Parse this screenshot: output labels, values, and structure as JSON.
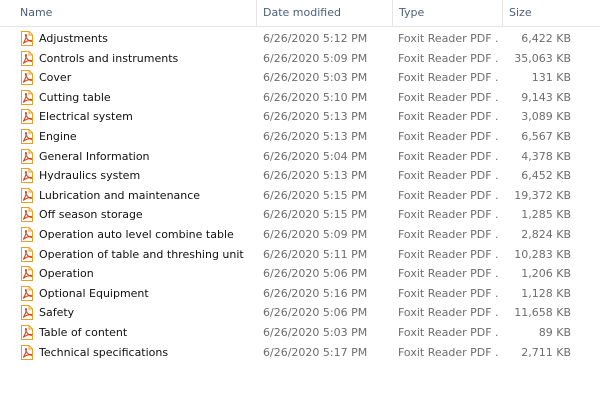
{
  "columns": {
    "name": "Name",
    "date": "Date modified",
    "type": "Type",
    "size": "Size"
  },
  "sort": {
    "column": "name",
    "arrow": "^"
  },
  "files": [
    {
      "name": "Adjustments",
      "date": "6/26/2020 5:12 PM",
      "type": "Foxit Reader PDF ...",
      "size": "6,422 KB"
    },
    {
      "name": "Controls and instruments",
      "date": "6/26/2020 5:09 PM",
      "type": "Foxit Reader PDF ...",
      "size": "35,063 KB"
    },
    {
      "name": "Cover",
      "date": "6/26/2020 5:03 PM",
      "type": "Foxit Reader PDF ...",
      "size": "131 KB"
    },
    {
      "name": "Cutting table",
      "date": "6/26/2020 5:10 PM",
      "type": "Foxit Reader PDF ...",
      "size": "9,143 KB"
    },
    {
      "name": "Electrical system",
      "date": "6/26/2020 5:13 PM",
      "type": "Foxit Reader PDF ...",
      "size": "3,089 KB"
    },
    {
      "name": "Engine",
      "date": "6/26/2020 5:13 PM",
      "type": "Foxit Reader PDF ...",
      "size": "6,567 KB"
    },
    {
      "name": "General Information",
      "date": "6/26/2020 5:04 PM",
      "type": "Foxit Reader PDF ...",
      "size": "4,378 KB"
    },
    {
      "name": "Hydraulics system",
      "date": "6/26/2020 5:13 PM",
      "type": "Foxit Reader PDF ...",
      "size": "6,452 KB"
    },
    {
      "name": "Lubrication and maintenance",
      "date": "6/26/2020 5:15 PM",
      "type": "Foxit Reader PDF ...",
      "size": "19,372 KB"
    },
    {
      "name": "Off season storage",
      "date": "6/26/2020 5:15 PM",
      "type": "Foxit Reader PDF ...",
      "size": "1,285 KB"
    },
    {
      "name": "Operation auto level combine table",
      "date": "6/26/2020 5:09 PM",
      "type": "Foxit Reader PDF ...",
      "size": "2,824 KB"
    },
    {
      "name": "Operation of table and threshing unit",
      "date": "6/26/2020 5:11 PM",
      "type": "Foxit Reader PDF ...",
      "size": "10,283 KB"
    },
    {
      "name": "Operation",
      "date": "6/26/2020 5:06 PM",
      "type": "Foxit Reader PDF ...",
      "size": "1,206 KB"
    },
    {
      "name": "Optional Equipment",
      "date": "6/26/2020 5:16 PM",
      "type": "Foxit Reader PDF ...",
      "size": "1,128 KB"
    },
    {
      "name": "Safety",
      "date": "6/26/2020 5:06 PM",
      "type": "Foxit Reader PDF ...",
      "size": "11,658 KB"
    },
    {
      "name": "Table of content",
      "date": "6/26/2020 5:03 PM",
      "type": "Foxit Reader PDF ...",
      "size": "89 KB"
    },
    {
      "name": "Technical specifications",
      "date": "6/26/2020 5:17 PM",
      "type": "Foxit Reader PDF ...",
      "size": "2,711 KB"
    }
  ],
  "icon": {
    "name": "foxit-pdf-file-icon",
    "page_color": "#ffffff",
    "accent_color": "#e8a020",
    "mark_color": "#d9441c"
  }
}
